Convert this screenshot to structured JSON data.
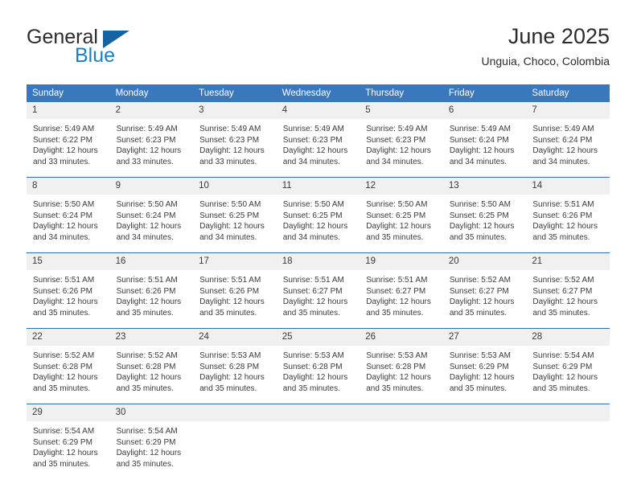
{
  "brand": {
    "name_part1": "General",
    "name_part2": "Blue",
    "accent_color": "#1464a5",
    "blue_text_color": "#1b7fc4"
  },
  "header": {
    "title": "June 2025",
    "subtitle": "Unguia, Choco, Colombia"
  },
  "theme": {
    "header_bg": "#3a78bd",
    "row_separator": "#2f6cb0",
    "daynum_bg": "#f0f0f0",
    "text_color": "#3a3a3a"
  },
  "weekday_headers": [
    "Sunday",
    "Monday",
    "Tuesday",
    "Wednesday",
    "Thursday",
    "Friday",
    "Saturday"
  ],
  "weeks": [
    [
      {
        "day": "1",
        "sunrise": "Sunrise: 5:49 AM",
        "sunset": "Sunset: 6:22 PM",
        "daylight_line1": "Daylight: 12 hours",
        "daylight_line2": "and 33 minutes."
      },
      {
        "day": "2",
        "sunrise": "Sunrise: 5:49 AM",
        "sunset": "Sunset: 6:23 PM",
        "daylight_line1": "Daylight: 12 hours",
        "daylight_line2": "and 33 minutes."
      },
      {
        "day": "3",
        "sunrise": "Sunrise: 5:49 AM",
        "sunset": "Sunset: 6:23 PM",
        "daylight_line1": "Daylight: 12 hours",
        "daylight_line2": "and 33 minutes."
      },
      {
        "day": "4",
        "sunrise": "Sunrise: 5:49 AM",
        "sunset": "Sunset: 6:23 PM",
        "daylight_line1": "Daylight: 12 hours",
        "daylight_line2": "and 34 minutes."
      },
      {
        "day": "5",
        "sunrise": "Sunrise: 5:49 AM",
        "sunset": "Sunset: 6:23 PM",
        "daylight_line1": "Daylight: 12 hours",
        "daylight_line2": "and 34 minutes."
      },
      {
        "day": "6",
        "sunrise": "Sunrise: 5:49 AM",
        "sunset": "Sunset: 6:24 PM",
        "daylight_line1": "Daylight: 12 hours",
        "daylight_line2": "and 34 minutes."
      },
      {
        "day": "7",
        "sunrise": "Sunrise: 5:49 AM",
        "sunset": "Sunset: 6:24 PM",
        "daylight_line1": "Daylight: 12 hours",
        "daylight_line2": "and 34 minutes."
      }
    ],
    [
      {
        "day": "8",
        "sunrise": "Sunrise: 5:50 AM",
        "sunset": "Sunset: 6:24 PM",
        "daylight_line1": "Daylight: 12 hours",
        "daylight_line2": "and 34 minutes."
      },
      {
        "day": "9",
        "sunrise": "Sunrise: 5:50 AM",
        "sunset": "Sunset: 6:24 PM",
        "daylight_line1": "Daylight: 12 hours",
        "daylight_line2": "and 34 minutes."
      },
      {
        "day": "10",
        "sunrise": "Sunrise: 5:50 AM",
        "sunset": "Sunset: 6:25 PM",
        "daylight_line1": "Daylight: 12 hours",
        "daylight_line2": "and 34 minutes."
      },
      {
        "day": "11",
        "sunrise": "Sunrise: 5:50 AM",
        "sunset": "Sunset: 6:25 PM",
        "daylight_line1": "Daylight: 12 hours",
        "daylight_line2": "and 34 minutes."
      },
      {
        "day": "12",
        "sunrise": "Sunrise: 5:50 AM",
        "sunset": "Sunset: 6:25 PM",
        "daylight_line1": "Daylight: 12 hours",
        "daylight_line2": "and 35 minutes."
      },
      {
        "day": "13",
        "sunrise": "Sunrise: 5:50 AM",
        "sunset": "Sunset: 6:25 PM",
        "daylight_line1": "Daylight: 12 hours",
        "daylight_line2": "and 35 minutes."
      },
      {
        "day": "14",
        "sunrise": "Sunrise: 5:51 AM",
        "sunset": "Sunset: 6:26 PM",
        "daylight_line1": "Daylight: 12 hours",
        "daylight_line2": "and 35 minutes."
      }
    ],
    [
      {
        "day": "15",
        "sunrise": "Sunrise: 5:51 AM",
        "sunset": "Sunset: 6:26 PM",
        "daylight_line1": "Daylight: 12 hours",
        "daylight_line2": "and 35 minutes."
      },
      {
        "day": "16",
        "sunrise": "Sunrise: 5:51 AM",
        "sunset": "Sunset: 6:26 PM",
        "daylight_line1": "Daylight: 12 hours",
        "daylight_line2": "and 35 minutes."
      },
      {
        "day": "17",
        "sunrise": "Sunrise: 5:51 AM",
        "sunset": "Sunset: 6:26 PM",
        "daylight_line1": "Daylight: 12 hours",
        "daylight_line2": "and 35 minutes."
      },
      {
        "day": "18",
        "sunrise": "Sunrise: 5:51 AM",
        "sunset": "Sunset: 6:27 PM",
        "daylight_line1": "Daylight: 12 hours",
        "daylight_line2": "and 35 minutes."
      },
      {
        "day": "19",
        "sunrise": "Sunrise: 5:51 AM",
        "sunset": "Sunset: 6:27 PM",
        "daylight_line1": "Daylight: 12 hours",
        "daylight_line2": "and 35 minutes."
      },
      {
        "day": "20",
        "sunrise": "Sunrise: 5:52 AM",
        "sunset": "Sunset: 6:27 PM",
        "daylight_line1": "Daylight: 12 hours",
        "daylight_line2": "and 35 minutes."
      },
      {
        "day": "21",
        "sunrise": "Sunrise: 5:52 AM",
        "sunset": "Sunset: 6:27 PM",
        "daylight_line1": "Daylight: 12 hours",
        "daylight_line2": "and 35 minutes."
      }
    ],
    [
      {
        "day": "22",
        "sunrise": "Sunrise: 5:52 AM",
        "sunset": "Sunset: 6:28 PM",
        "daylight_line1": "Daylight: 12 hours",
        "daylight_line2": "and 35 minutes."
      },
      {
        "day": "23",
        "sunrise": "Sunrise: 5:52 AM",
        "sunset": "Sunset: 6:28 PM",
        "daylight_line1": "Daylight: 12 hours",
        "daylight_line2": "and 35 minutes."
      },
      {
        "day": "24",
        "sunrise": "Sunrise: 5:53 AM",
        "sunset": "Sunset: 6:28 PM",
        "daylight_line1": "Daylight: 12 hours",
        "daylight_line2": "and 35 minutes."
      },
      {
        "day": "25",
        "sunrise": "Sunrise: 5:53 AM",
        "sunset": "Sunset: 6:28 PM",
        "daylight_line1": "Daylight: 12 hours",
        "daylight_line2": "and 35 minutes."
      },
      {
        "day": "26",
        "sunrise": "Sunrise: 5:53 AM",
        "sunset": "Sunset: 6:28 PM",
        "daylight_line1": "Daylight: 12 hours",
        "daylight_line2": "and 35 minutes."
      },
      {
        "day": "27",
        "sunrise": "Sunrise: 5:53 AM",
        "sunset": "Sunset: 6:29 PM",
        "daylight_line1": "Daylight: 12 hours",
        "daylight_line2": "and 35 minutes."
      },
      {
        "day": "28",
        "sunrise": "Sunrise: 5:54 AM",
        "sunset": "Sunset: 6:29 PM",
        "daylight_line1": "Daylight: 12 hours",
        "daylight_line2": "and 35 minutes."
      }
    ],
    [
      {
        "day": "29",
        "sunrise": "Sunrise: 5:54 AM",
        "sunset": "Sunset: 6:29 PM",
        "daylight_line1": "Daylight: 12 hours",
        "daylight_line2": "and 35 minutes."
      },
      {
        "day": "30",
        "sunrise": "Sunrise: 5:54 AM",
        "sunset": "Sunset: 6:29 PM",
        "daylight_line1": "Daylight: 12 hours",
        "daylight_line2": "and 35 minutes."
      },
      {
        "day": "",
        "sunrise": "",
        "sunset": "",
        "daylight_line1": "",
        "daylight_line2": ""
      },
      {
        "day": "",
        "sunrise": "",
        "sunset": "",
        "daylight_line1": "",
        "daylight_line2": ""
      },
      {
        "day": "",
        "sunrise": "",
        "sunset": "",
        "daylight_line1": "",
        "daylight_line2": ""
      },
      {
        "day": "",
        "sunrise": "",
        "sunset": "",
        "daylight_line1": "",
        "daylight_line2": ""
      },
      {
        "day": "",
        "sunrise": "",
        "sunset": "",
        "daylight_line1": "",
        "daylight_line2": ""
      }
    ]
  ]
}
